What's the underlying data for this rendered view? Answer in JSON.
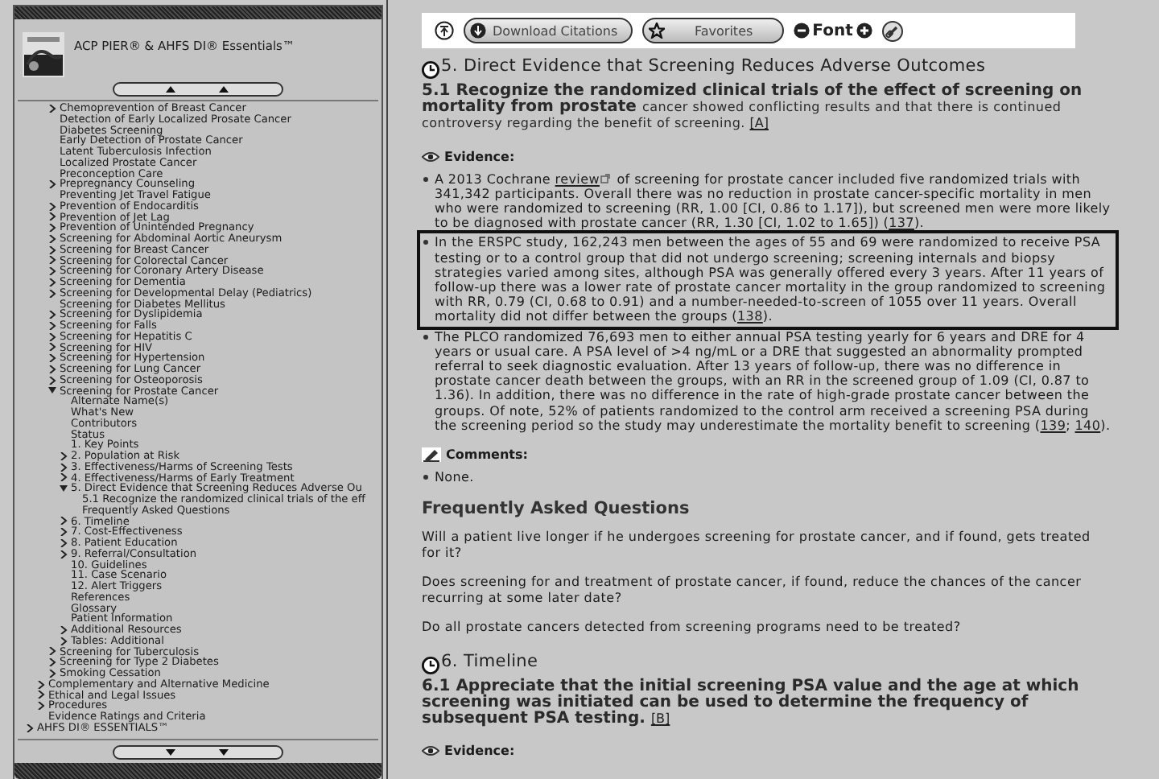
{
  "sidebar": {
    "title": "ACP PIER® & AHFS DI® Essentials™",
    "tree": [
      {
        "children": [
          {
            "children": [
              {
                "label": "Chemoprevention of Breast Cancer",
                "expanded": false
              },
              {
                "label": "Detection of Early Localized Prosate Cancer"
              },
              {
                "label": "Diabetes Screening"
              },
              {
                "label": "Early Detection of Prostate Cancer"
              },
              {
                "label": "Latent Tuberculosis Infection"
              },
              {
                "label": "Localized Prostate Cancer"
              },
              {
                "label": "Preconception Care"
              },
              {
                "label": "Prepregnancy Counseling",
                "expanded": false
              },
              {
                "label": "Preventing Jet Travel Fatigue"
              },
              {
                "label": "Prevention of Endocarditis",
                "expanded": false
              },
              {
                "label": "Prevention of Jet Lag",
                "expanded": false
              },
              {
                "label": "Prevention of Unintended Pregnancy",
                "expanded": false
              },
              {
                "label": "Screening for Abdominal Aortic Aneurysm",
                "expanded": false
              },
              {
                "label": "Screening for Breast Cancer",
                "expanded": false
              },
              {
                "label": "Screening for Colorectal Cancer",
                "expanded": false
              },
              {
                "label": "Screening for Coronary Artery Disease",
                "expanded": false
              },
              {
                "label": "Screening for Dementia",
                "expanded": false
              },
              {
                "label": "Screening for Developmental Delay (Pediatrics)",
                "expanded": false
              },
              {
                "label": "Screening for Diabetes Mellitus"
              },
              {
                "label": "Screening for Dyslipidemia",
                "expanded": false
              },
              {
                "label": "Screening for Falls",
                "expanded": false
              },
              {
                "label": "Screening for Hepatitis C",
                "expanded": false
              },
              {
                "label": "Screening for HIV",
                "expanded": false
              },
              {
                "label": "Screening for Hypertension",
                "expanded": false
              },
              {
                "label": "Screening for Lung Cancer",
                "expanded": false
              },
              {
                "label": "Screening for Osteoporosis",
                "expanded": false
              },
              {
                "label": "Screening for Prostate Cancer",
                "expanded": true,
                "children": [
                  {
                    "label": "Alternate Name(s)"
                  },
                  {
                    "label": "What's New"
                  },
                  {
                    "label": "Contributors"
                  },
                  {
                    "label": "Status"
                  },
                  {
                    "label": "1. Key Points"
                  },
                  {
                    "label": "2. Population at Risk",
                    "expanded": false
                  },
                  {
                    "label": "3. Effectiveness/Harms of Screening Tests",
                    "expanded": false
                  },
                  {
                    "label": "4. Effectiveness/Harms of Early Treatment",
                    "expanded": false
                  },
                  {
                    "label": "5. Direct Evidence that Screening Reduces Adverse Ou",
                    "expanded": true,
                    "children": [
                      {
                        "label": "5.1 Recognize the randomized clinical trials of the eff"
                      },
                      {
                        "label": "Frequently Asked Questions"
                      }
                    ]
                  },
                  {
                    "label": "6. Timeline",
                    "expanded": false
                  },
                  {
                    "label": "7. Cost-Effectiveness",
                    "expanded": false
                  },
                  {
                    "label": "8. Patient Education",
                    "expanded": false
                  },
                  {
                    "label": "9. Referral/Consultation",
                    "expanded": false
                  },
                  {
                    "label": "10. Guidelines"
                  },
                  {
                    "label": "11. Case Scenario"
                  },
                  {
                    "label": "12. Alert Triggers"
                  },
                  {
                    "label": "References"
                  },
                  {
                    "label": "Glossary"
                  },
                  {
                    "label": "Patient Information"
                  },
                  {
                    "label": "Additional Resources",
                    "expanded": false
                  },
                  {
                    "label": "Tables: Additional",
                    "expanded": false
                  }
                ]
              },
              {
                "label": "Screening for Tuberculosis",
                "expanded": false
              },
              {
                "label": "Screening for Type 2 Diabetes",
                "expanded": false
              },
              {
                "label": "Smoking Cessation",
                "expanded": false
              }
            ]
          },
          {
            "label": "Complementary and Alternative Medicine",
            "expanded": false
          },
          {
            "label": "Ethical and Legal Issues",
            "expanded": false
          },
          {
            "label": "Procedures",
            "expanded": false
          },
          {
            "label": "Evidence Ratings and Criteria"
          }
        ]
      },
      {
        "label": "AHFS DI® ESSENTIALS™",
        "expanded": false
      }
    ]
  },
  "toolbar": {
    "download_label": "Download Citations",
    "favorites_label": "Favorites",
    "font_label": "Font"
  },
  "sections": [
    {
      "title": "5. Direct Evidence that Screening Reduces Adverse Outcomes",
      "subsections": [
        {
          "title": "5.1 Recognize the randomized clinical trials of the effect of screening on mortality from prostate",
          "title_tail": "cancer showed conflicting results and that there is continued controversy regarding the benefit of screening.",
          "grade": "[A]",
          "evidence_label": "Evidence:",
          "evidence": [
            {
              "highlighted": false,
              "parts": [
                {
                  "kind": "text",
                  "text": "A 2013 Cochrane "
                },
                {
                  "kind": "link",
                  "text": "review",
                  "external": true
                },
                {
                  "kind": "text",
                  "text": " of screening for prostate cancer included five randomized trials with 341,342 participants. Overall there was no reduction in prostate cancer-specific mortality in men who were randomized to screening (RR, 1.00 [CI, 0.86 to 1.17]), but screened men were more likely to be diagnosed with prostate cancer (RR, 1.30 [CI, 1.02 to 1.65]) ("
                },
                {
                  "kind": "link",
                  "text": "137"
                },
                {
                  "kind": "text",
                  "text": ")."
                }
              ]
            },
            {
              "highlighted": true,
              "parts": [
                {
                  "kind": "text",
                  "text": "In the ERSPC study, 162,243 men between the ages of 55 and 69 were randomized to receive PSA testing or to a control group that did not undergo screening; screening internals and biopsy strategies varied among sites, although PSA was generally offered every 3 years. After 11 years of follow-up there was a lower rate of prostate cancer mortality in the group randomized to screening with RR, 0.79 (CI, 0.68 to 0.91) and a number-needed-to-screen of 1055 over 11 years. Overall mortality did not differ between the groups ("
                },
                {
                  "kind": "link",
                  "text": "138"
                },
                {
                  "kind": "text",
                  "text": ")."
                }
              ]
            },
            {
              "highlighted": false,
              "parts": [
                {
                  "kind": "text",
                  "text": "The PLCO randomized 76,693 men to either annual PSA testing yearly for 6 years and DRE for 4 years or usual care. A PSA level of >4 ng/mL or a DRE that suggested an abnormality prompted referral to seek diagnostic evaluation. After 13 years of follow-up, there was no difference in prostate cancer death between the groups, with an RR in the screened group of 1.09 (CI, 0.87 to 1.36). In addition, there was no difference in the rate of high-grade prostate cancer between the groups. Of note, 52% of patients randomized to the control arm received a screening PSA during the screening period so the study may underestimate the mortality benefit to screening ("
                },
                {
                  "kind": "link",
                  "text": "139"
                },
                {
                  "kind": "text",
                  "text": "; "
                },
                {
                  "kind": "link",
                  "text": "140"
                },
                {
                  "kind": "text",
                  "text": ")."
                }
              ]
            }
          ],
          "comments_label": "Comments:",
          "comments": [
            "None."
          ]
        }
      ],
      "faq": {
        "title": "Frequently Asked Questions",
        "questions": [
          "Will a patient live longer if he undergoes screening for prostate cancer, and if found, gets treated for it?",
          "Does screening for and treatment of prostate cancer, if found, reduce the chances of the cancer recurring at some later date?",
          "Do all prostate cancers detected from screening programs need to be treated?"
        ]
      }
    },
    {
      "title": "6. Timeline",
      "subsections": [
        {
          "title": "6.1 Appreciate that the initial screening PSA value and the age at which screening was initiated can be used to determine the frequency of subsequent PSA testing.",
          "grade": "[B]",
          "evidence_label": "Evidence:"
        }
      ]
    }
  ]
}
